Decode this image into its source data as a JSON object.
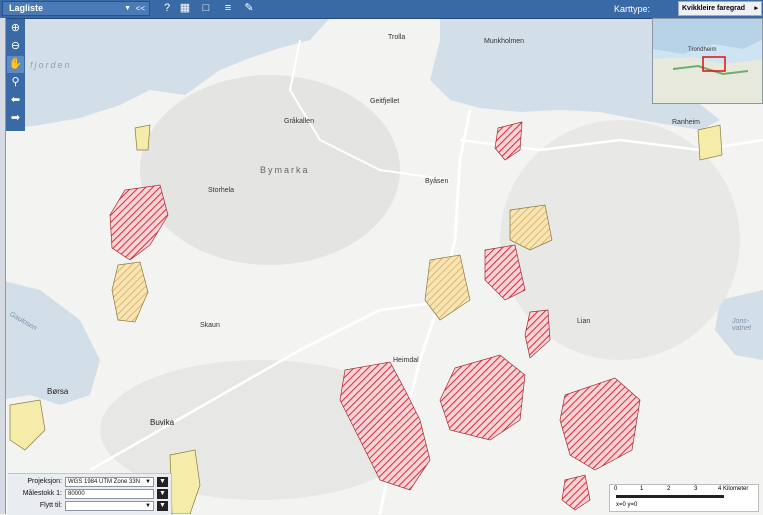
{
  "header": {
    "layer_label": "Lagliste",
    "layer_collapse": "<<",
    "map_type_label": "Karttype:",
    "map_type_value": "Kvikkleire faregrad"
  },
  "toolbar_top_icons": [
    "help-icon",
    "grid-icon",
    "comment-icon",
    "list-icon",
    "draw-icon"
  ],
  "nav_tools": [
    "zoom-in-icon",
    "zoom-out-icon",
    "pan-icon",
    "zoom-box-icon",
    "back-icon",
    "forward-icon"
  ],
  "overview": {
    "city_label": "Trondheim"
  },
  "bottom_panel": {
    "projection_label": "Projeksjon:",
    "projection_value": "WGS 1984 UTM Zone 33N",
    "scale_label": "Målestokk 1:",
    "scale_value": "80000",
    "move_label": "Flytt til:",
    "move_value": ""
  },
  "scale": {
    "ticks": [
      "0",
      "1",
      "2",
      "3",
      "4 Kilometer"
    ],
    "coords": "x=0 y=0"
  },
  "places": {
    "trondheim": "TRONDHEIM",
    "trolla": "Trolla",
    "munkholmen": "Munkholmen",
    "bymarka": "Bymarka",
    "storhela": "Storhela",
    "geitfjellet": "Geitfjellet",
    "granasen": "Gråkallen",
    "byasen": "Byåsen",
    "heimdal": "Heimdal",
    "borsa": "Børsa",
    "buvika": "Buvika",
    "ranheim": "Ranheim",
    "lian": "Lian",
    "fjorden": "fjorden",
    "jonsvatnet": "Jons-vatnet",
    "gaulosen": "Gaulosen",
    "skaun": "Skaun"
  },
  "colors": {
    "high_hazard": "#e0283a",
    "medium_hazard": "#f0c060",
    "low_hazard": "#f4eca8",
    "header": "#3a6aa6",
    "water": "#d3dfe8"
  }
}
